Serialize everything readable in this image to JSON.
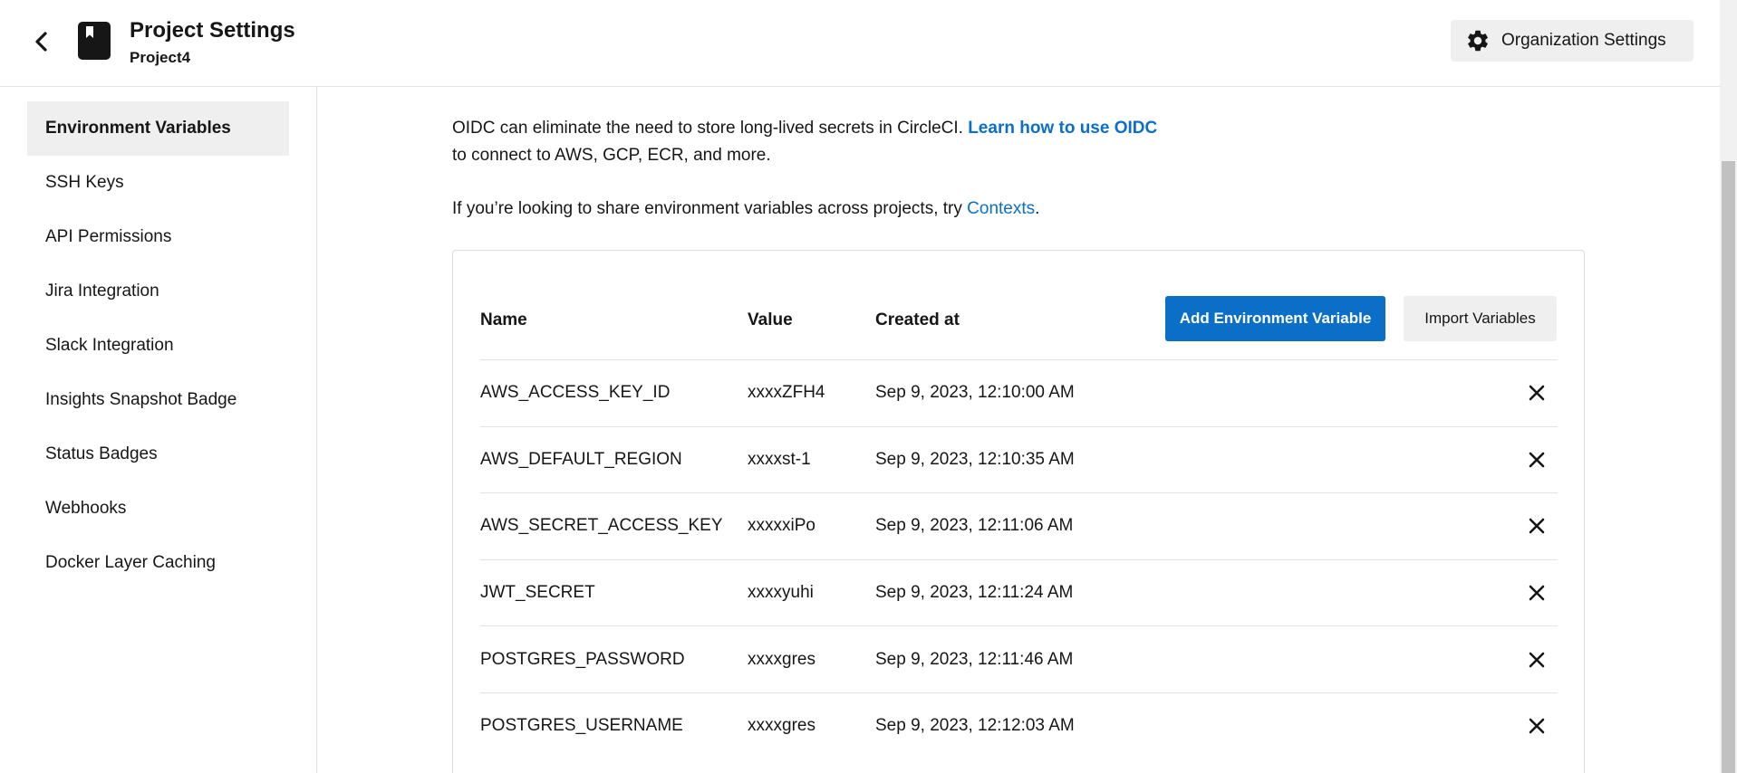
{
  "header": {
    "title": "Project Settings",
    "project": "Project4",
    "org_settings_label": "Organization Settings"
  },
  "sidebar": {
    "items": [
      {
        "label": "Environment Variables",
        "active": true
      },
      {
        "label": "SSH Keys"
      },
      {
        "label": "API Permissions"
      },
      {
        "label": "Jira Integration"
      },
      {
        "label": "Slack Integration"
      },
      {
        "label": "Insights Snapshot Badge"
      },
      {
        "label": "Status Badges"
      },
      {
        "label": "Webhooks"
      },
      {
        "label": "Docker Layer Caching"
      }
    ]
  },
  "main": {
    "oidc_text_1": "OIDC can eliminate the need to store long-lived secrets in CircleCI.",
    "oidc_link": "Learn how to use OIDC",
    "oidc_text_2": "to connect to AWS, GCP, ECR, and more.",
    "contexts_text": "If you’re looking to share environment variables across projects, try",
    "contexts_link": "Contexts",
    "contexts_period": "."
  },
  "table": {
    "headers": {
      "name": "Name",
      "value": "Value",
      "created": "Created at"
    },
    "add_button": "Add Environment Variable",
    "import_button": "Import Variables",
    "rows": [
      {
        "name": "AWS_ACCESS_KEY_ID",
        "value": "xxxxZFH4",
        "created": "Sep 9, 2023, 12:10:00 AM"
      },
      {
        "name": "AWS_DEFAULT_REGION",
        "value": "xxxxst-1",
        "created": "Sep 9, 2023, 12:10:35 AM"
      },
      {
        "name": "AWS_SECRET_ACCESS_KEY",
        "value": "xxxxxiPo",
        "created": "Sep 9, 2023, 12:11:06 AM"
      },
      {
        "name": "JWT_SECRET",
        "value": "xxxxyuhi",
        "created": "Sep 9, 2023, 12:11:24 AM"
      },
      {
        "name": "POSTGRES_PASSWORD",
        "value": "xxxxgres",
        "created": "Sep 9, 2023, 12:11:46 AM"
      },
      {
        "name": "POSTGRES_USERNAME",
        "value": "xxxxgres",
        "created": "Sep 9, 2023, 12:12:03 AM"
      }
    ]
  },
  "colors": {
    "accent": "#0b6fc8",
    "active_bg": "#efefef",
    "border": "#e3e3e3"
  },
  "icons": {
    "back": "chevron-left-icon",
    "project": "bookmark-book-icon",
    "org_settings": "gear-icon",
    "delete": "close-icon"
  }
}
